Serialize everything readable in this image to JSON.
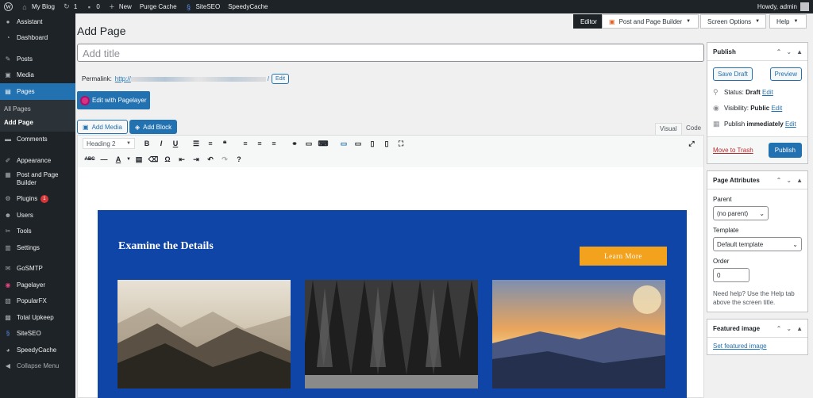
{
  "adminbar": {
    "site_name": "My Blog",
    "updates_count": "1",
    "comments_count": "0",
    "new_label": "New",
    "purge_cache": "Purge Cache",
    "siteseo": "SiteSEO",
    "speedycache": "SpeedyCache",
    "howdy": "Howdy, admin"
  },
  "menu": {
    "assistant": "Assistant",
    "dashboard": "Dashboard",
    "posts": "Posts",
    "media": "Media",
    "pages": "Pages",
    "all_pages": "All Pages",
    "add_page": "Add Page",
    "comments": "Comments",
    "appearance": "Appearance",
    "post_page_builder": "Post and Page Builder",
    "plugins": "Plugins",
    "plugins_badge": "1",
    "users": "Users",
    "tools": "Tools",
    "settings": "Settings",
    "gosmtp": "GoSMTP",
    "pagelayer": "Pagelayer",
    "popularfx": "PopularFX",
    "total_upkeep": "Total Upkeep",
    "siteseo": "SiteSEO",
    "speedycache": "SpeedyCache",
    "collapse": "Collapse Menu"
  },
  "top": {
    "editor_tab": "Editor",
    "builder_tab": "Post and Page Builder",
    "screen_options": "Screen Options",
    "help": "Help"
  },
  "page": {
    "heading": "Add Page",
    "title_placeholder": "Add title",
    "permalink_label": "Permalink:",
    "permalink_url": "http://",
    "permalink_end": "/",
    "edit": "Edit",
    "edit_with_pagelayer": "Edit with Pagelayer",
    "add_media": "Add Media",
    "add_block": "Add Block",
    "visual_tab": "Visual",
    "code_tab": "Code",
    "format_select": "Heading 2"
  },
  "content": {
    "heading": "Examine the Details",
    "button": "Learn More"
  },
  "publish": {
    "title": "Publish",
    "save_draft": "Save Draft",
    "preview": "Preview",
    "status_label": "Status:",
    "status_value": "Draft",
    "status_edit": "Edit",
    "visibility_label": "Visibility:",
    "visibility_value": "Public",
    "visibility_edit": "Edit",
    "publish_label": "Publish",
    "publish_value": "immediately",
    "publish_edit": "Edit",
    "trash": "Move to Trash",
    "publish_btn": "Publish"
  },
  "attributes": {
    "title": "Page Attributes",
    "parent_label": "Parent",
    "parent_value": "(no parent)",
    "template_label": "Template",
    "template_value": "Default template",
    "order_label": "Order",
    "order_value": "0",
    "help_text": "Need help? Use the Help tab above the screen title."
  },
  "featured": {
    "title": "Featured image",
    "set_link": "Set featured image"
  },
  "colors": {
    "adminbar": "#1d2327",
    "accent": "#2271b1",
    "banner": "#0f45a6",
    "button": "#f2a21c"
  }
}
